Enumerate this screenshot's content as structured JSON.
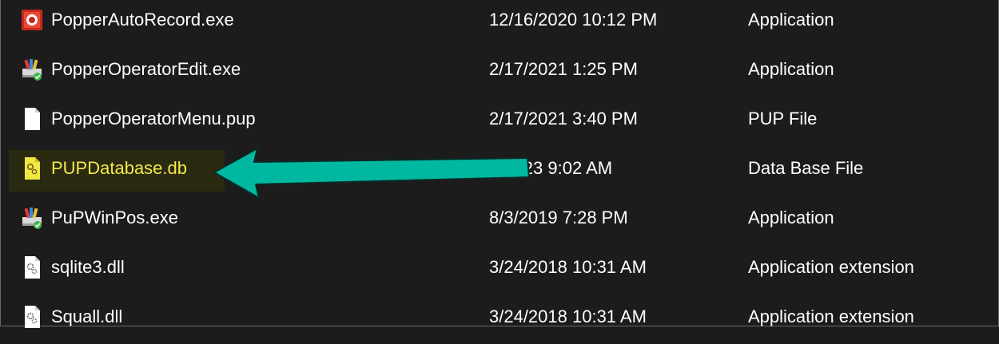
{
  "files": [
    {
      "name": "PopperAutoRecord.exe",
      "date": "12/16/2020 10:12 PM",
      "type": "Application",
      "icon": "record-app-icon"
    },
    {
      "name": "PopperOperatorEdit.exe",
      "date": "2/17/2021 1:25 PM",
      "type": "Application",
      "icon": "installer-app-icon"
    },
    {
      "name": "PopperOperatorMenu.pup",
      "date": "2/17/2021 3:40 PM",
      "type": "PUP File",
      "icon": "blank-file-icon"
    },
    {
      "name": "PUPDatabase.db",
      "date": "/ /2023 9:02 AM",
      "type": "Data Base File",
      "icon": "database-file-icon",
      "highlighted": true
    },
    {
      "name": "PuPWinPos.exe",
      "date": "8/3/2019 7:28 PM",
      "type": "Application",
      "icon": "installer-app-icon"
    },
    {
      "name": "sqlite3.dll",
      "date": "3/24/2018 10:31 AM",
      "type": "Application extension",
      "icon": "dll-gear-file-icon"
    },
    {
      "name": "Squall.dll",
      "date": "3/24/2018 10:31 AM",
      "type": "Application extension",
      "icon": "dll-gear-file-icon"
    }
  ],
  "annotation": {
    "arrow_color": "#00b8a0",
    "arrow_target": "PUPDatabase.db"
  },
  "colors": {
    "background": "#1c1c1c",
    "text": "#ffffff",
    "highlight_text": "#f4e84a",
    "highlight_bg": "#2a2a10"
  }
}
